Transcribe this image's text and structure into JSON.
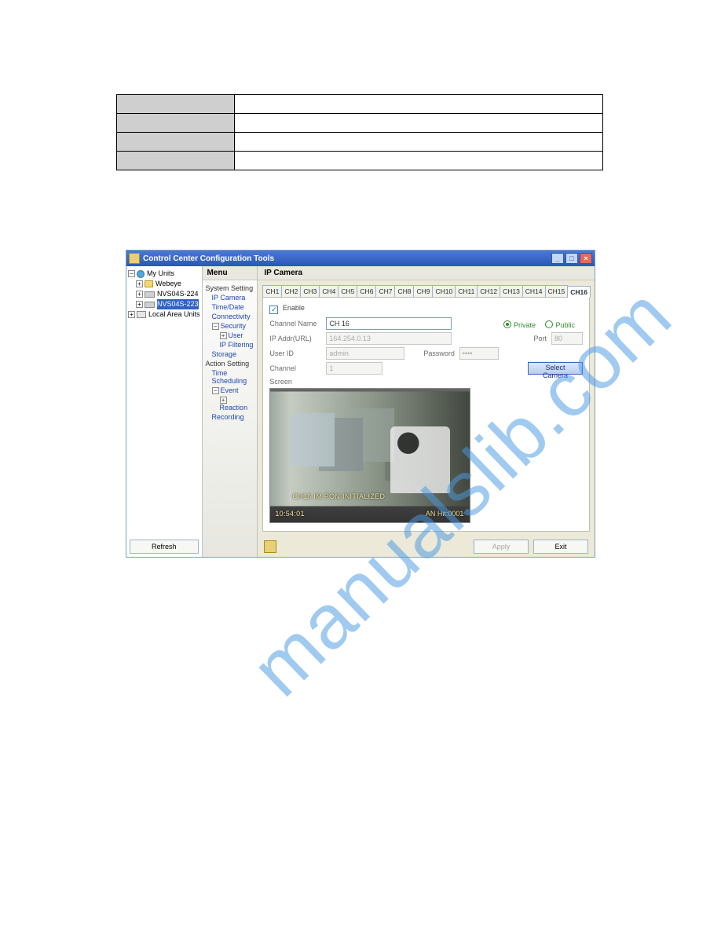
{
  "watermark": "manualslib.com",
  "upper_table": {
    "rows": 4
  },
  "window": {
    "title": "Control Center Configuration Tools",
    "winbtns": {
      "min": "_",
      "max": "□",
      "close": "×"
    }
  },
  "tree": {
    "root1": "My Units",
    "group1": "Webeye",
    "unit1": "NVS04S-224",
    "unit2": "NVS04S-223",
    "root2": "Local Area Units",
    "plus": "+",
    "minus": "−"
  },
  "refresh": "Refresh",
  "menu_header": "Menu",
  "menu": {
    "sys": "System Setting",
    "ipcam": "IP Camera",
    "timedate": "Time/Date",
    "conn": "Connectivity",
    "security": "Security",
    "user": "User",
    "ipfilt": "IP Filtering",
    "storage": "Storage",
    "action": "Action Setting",
    "sched": "Time Scheduling",
    "event": "Event",
    "reaction": "Reaction",
    "recording": "Recording"
  },
  "main_header": "IP Camera",
  "tabs": [
    "CH1",
    "CH2",
    "CH3",
    "CH4",
    "CH5",
    "CH6",
    "CH7",
    "CH8",
    "CH9",
    "CH10",
    "CH11",
    "CH12",
    "CH13",
    "CH14",
    "CH15",
    "CH16"
  ],
  "tabs_active": "CH16",
  "form": {
    "enable": "Enable",
    "channel_name_label": "Channel Name",
    "channel_name_value": "CH 16",
    "private": "Private",
    "public": "Public",
    "ip_label": "IP Addr(URL)",
    "ip_value": "164.254.0.13",
    "port_label": "Port",
    "port_value": "80",
    "user_label": "User ID",
    "user_value": "admin",
    "pass_label": "Password",
    "pass_value": "••••",
    "channel_label": "Channel",
    "channel_value": "1",
    "select_camera": "Select Camera",
    "screen_label": "Screen"
  },
  "screen_osd": {
    "line1": "CH16 IM  PON  INITIALIZED",
    "line2": "10:54:01",
    "line3": "AN  Hit:0001"
  },
  "footer": {
    "apply": "Apply",
    "exit": "Exit"
  }
}
